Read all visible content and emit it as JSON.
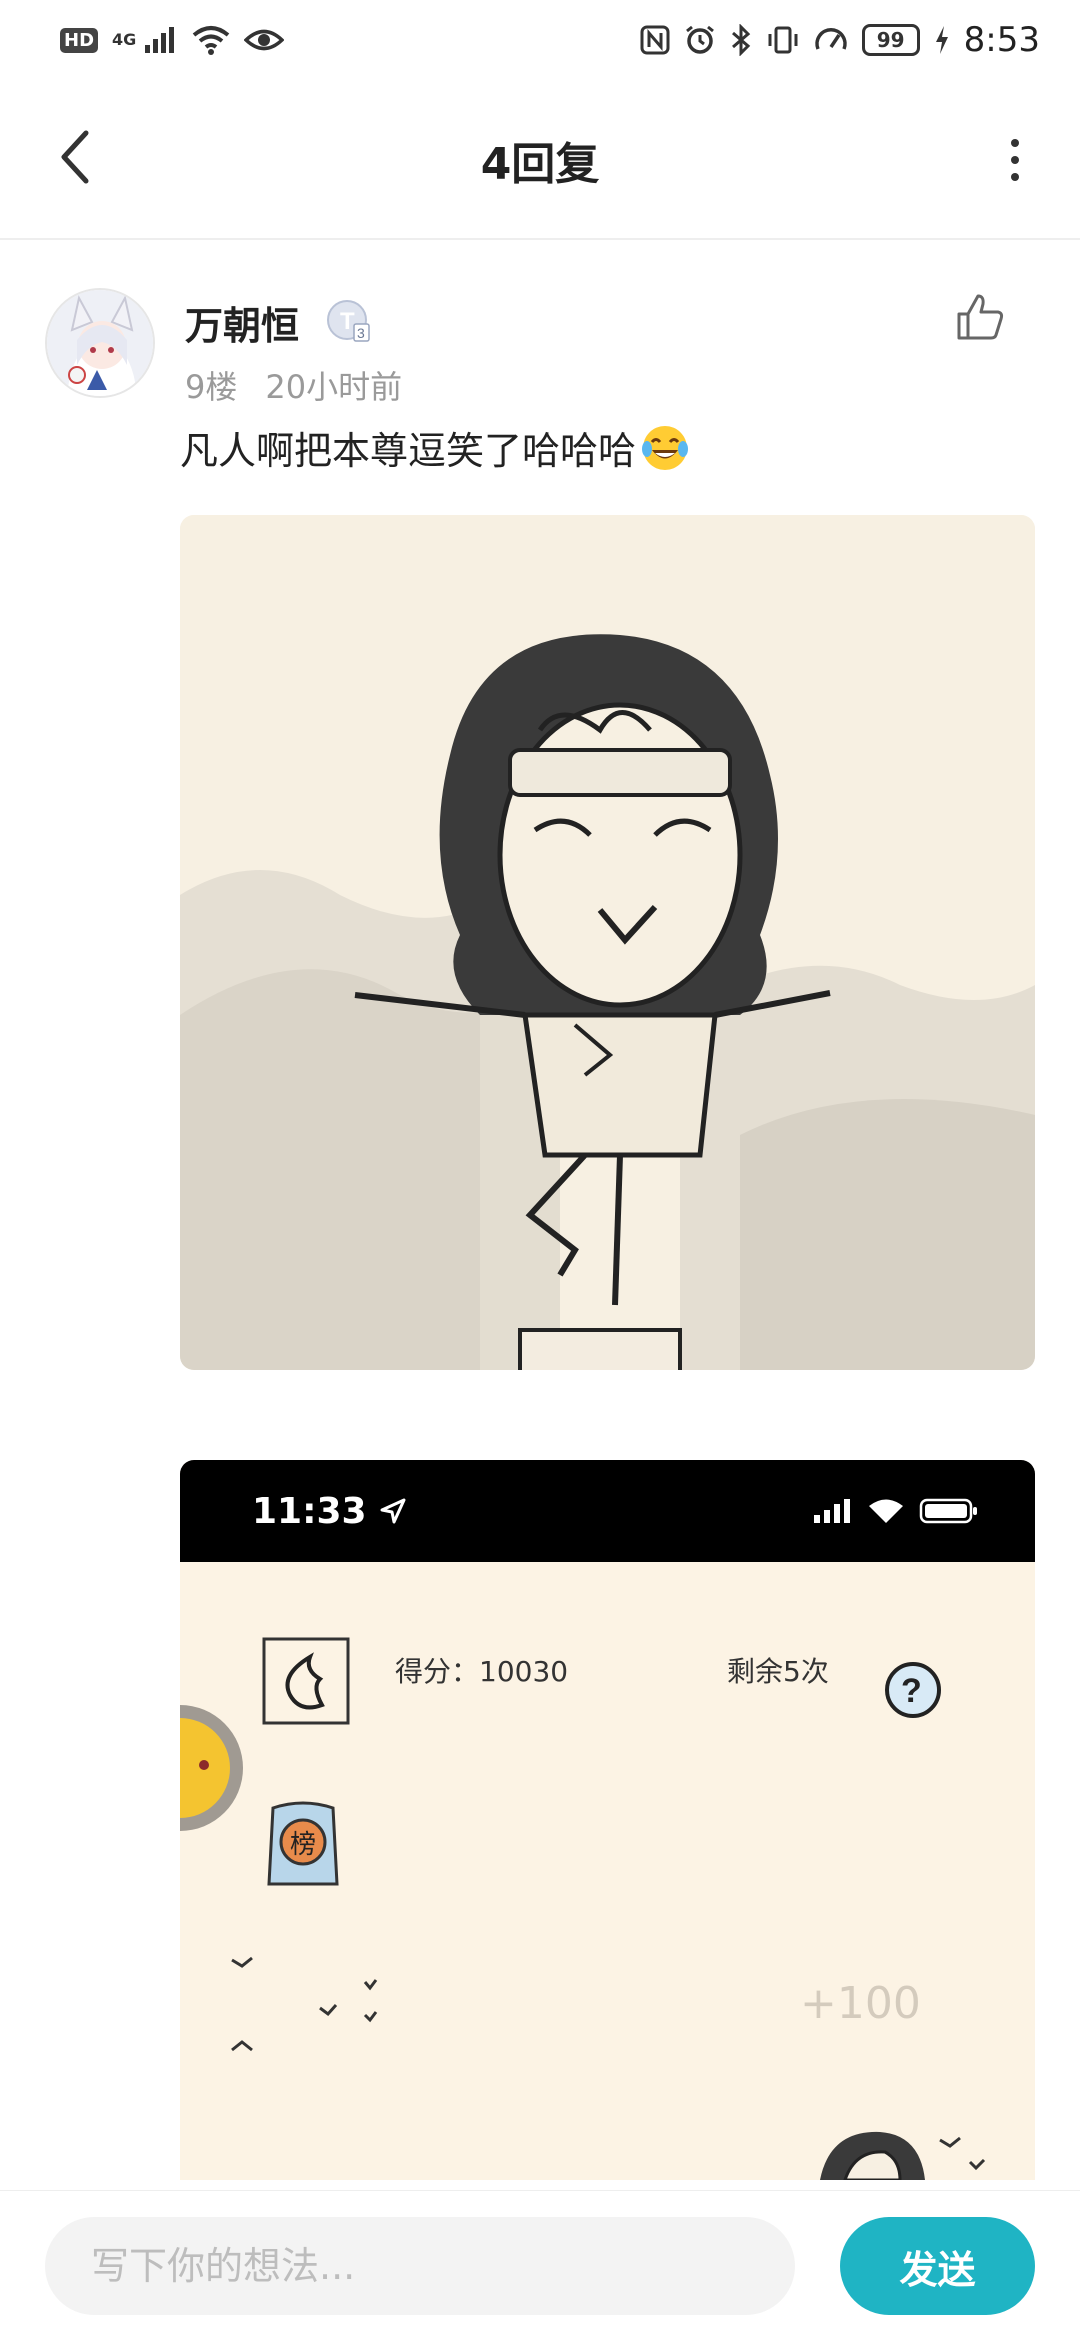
{
  "status_bar": {
    "hd_badge": "HD",
    "network_label": "4G",
    "battery_level": "99",
    "time": "8:53",
    "icons": [
      "signal-icon",
      "wifi-icon",
      "eye-icon",
      "nfc-icon",
      "alarm-icon",
      "bluetooth-icon",
      "vibrate-icon",
      "speed-icon",
      "battery-icon",
      "charging-icon"
    ]
  },
  "header": {
    "title": "4回复",
    "back_icon": "chevron-left-icon",
    "more_icon": "more-vertical-icon"
  },
  "post": {
    "username": "万朝恒",
    "level_badge": "T3",
    "floor": "9楼",
    "time_ago": "20小时前",
    "content": "凡人啊把本尊逗笑了哈哈哈",
    "emoji": "laughing-tears-emoji",
    "like_icon": "thumbs-up-icon"
  },
  "embedded_screenshot": {
    "time": "11:33",
    "score_text": "得分：10030",
    "remaining_text": "剩余5次",
    "rank_badge": "榜",
    "plus_score": "+100"
  },
  "bottom_bar": {
    "placeholder": "写下你的想法...",
    "send_label": "发送"
  },
  "colors": {
    "accent": "#1fb4c4",
    "meta_text": "#9a9a9a",
    "image_bg": "#f7f0e2"
  }
}
